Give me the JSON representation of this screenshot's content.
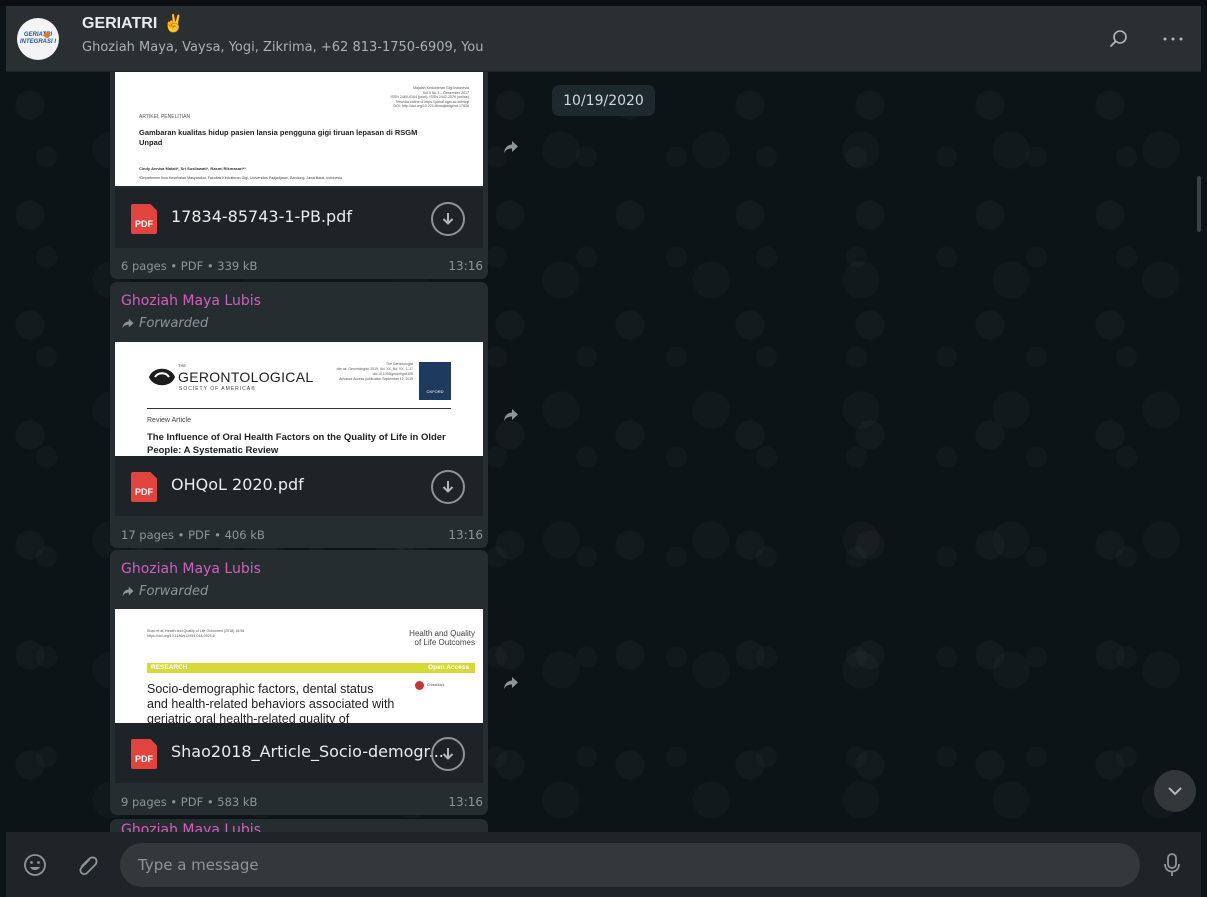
{
  "header": {
    "avatar_text": [
      "GERIATRI",
      "INTEGRASI I"
    ],
    "title": "GERIATRI",
    "title_emoji": "✌",
    "participants": "Ghoziah Maya, Vaysa, Yogi, Zikrima, +62 813-1750-6909, You",
    "icons": [
      "search-icon",
      "menu-dots-icon"
    ]
  },
  "chat": {
    "date_chip": "10/19/2020",
    "messages": [
      {
        "preview": {
          "journal_lines": [
            "Majalah Kedokteran Gigi Indonesia",
            "Vol 3 No 3 – Desember 2017",
            "ISSN 2460-0164 (print), ISSN 2442-2576 (online)",
            "Tersedia online di https://jurnal.ugm.ac.id/mkgi",
            "DOI: http://doi.org/10.22146/majkedgiind.17836"
          ],
          "section": "ARTIKEL PENELITIAN",
          "heading": "Gambaran kualitas hidup pasien lansia pengguna gigi tiruan lepasan di RSGM Unpad",
          "authors": "Cindy Annisa Malati*, Sri Susilawati*, Rasmi Rikmasari**",
          "affiliation": "*Departemen Ilmu Kesehatan Masyarakat, Fakultas Kedokteran Gigi, Universitas Padjadjaran, Bandung, Jawa Barat, Indonesia"
        },
        "file_name": "17834-85743-1-PB.pdf",
        "meta": "6 pages • PDF • 339 kB",
        "time": "13:16"
      },
      {
        "sender": "Ghoziah Maya Lubis",
        "forwarded": "Forwarded",
        "preview": {
          "brand_the": "THE",
          "brand": "GERONTOLOGICAL",
          "brand_sub": "SOCIETY OF AMERICA®",
          "right_lines": [
            "The Gerontologist",
            "cite as: Gerontologist, 2019, Vol. XX, No. XX, 1–17",
            "doi:10.1093/geront/gnz105",
            "Advance Access publication September 12, 2019"
          ],
          "oxford": "OXFORD",
          "section": "Review Article",
          "heading": "The Influence of Oral Health Factors on the Quality of Life in Older People: A Systematic Review"
        },
        "file_name": "OHQoL 2020.pdf",
        "meta": "17 pages • PDF • 406 kB",
        "time": "13:16"
      },
      {
        "sender": "Ghoziah Maya Lubis",
        "forwarded": "Forwarded",
        "preview": {
          "left_lines": [
            "Shao et al. Health and Quality of Life Outcomes (2018) 16:98",
            "https://doi.org/10.1186/s12955-018-0925-8"
          ],
          "right_title": [
            "Health and Quality",
            "of Life Outcomes"
          ],
          "research": "RESEARCH",
          "open_access": "Open Access",
          "crossmark": "CrossMark",
          "heading": "Socio-demographic factors, dental status and health-related behaviors associated with geriatric oral health-related quality of"
        },
        "file_name": "Shao2018_Article_Socio-demogr...",
        "meta": "9 pages • PDF • 583 kB",
        "time": "13:16"
      },
      {
        "sender": "Ghoziah Maya Lubis"
      }
    ]
  },
  "footer": {
    "placeholder": "Type a message",
    "icons": [
      "emoji-icon",
      "attach-icon",
      "microphone-icon"
    ]
  },
  "colors": {
    "header_bg": "#2a2f32",
    "chat_bg": "#0d1418",
    "bubble_bg": "#262d31",
    "sender": "#d35fbb",
    "pdf_red": "#e0443c"
  }
}
